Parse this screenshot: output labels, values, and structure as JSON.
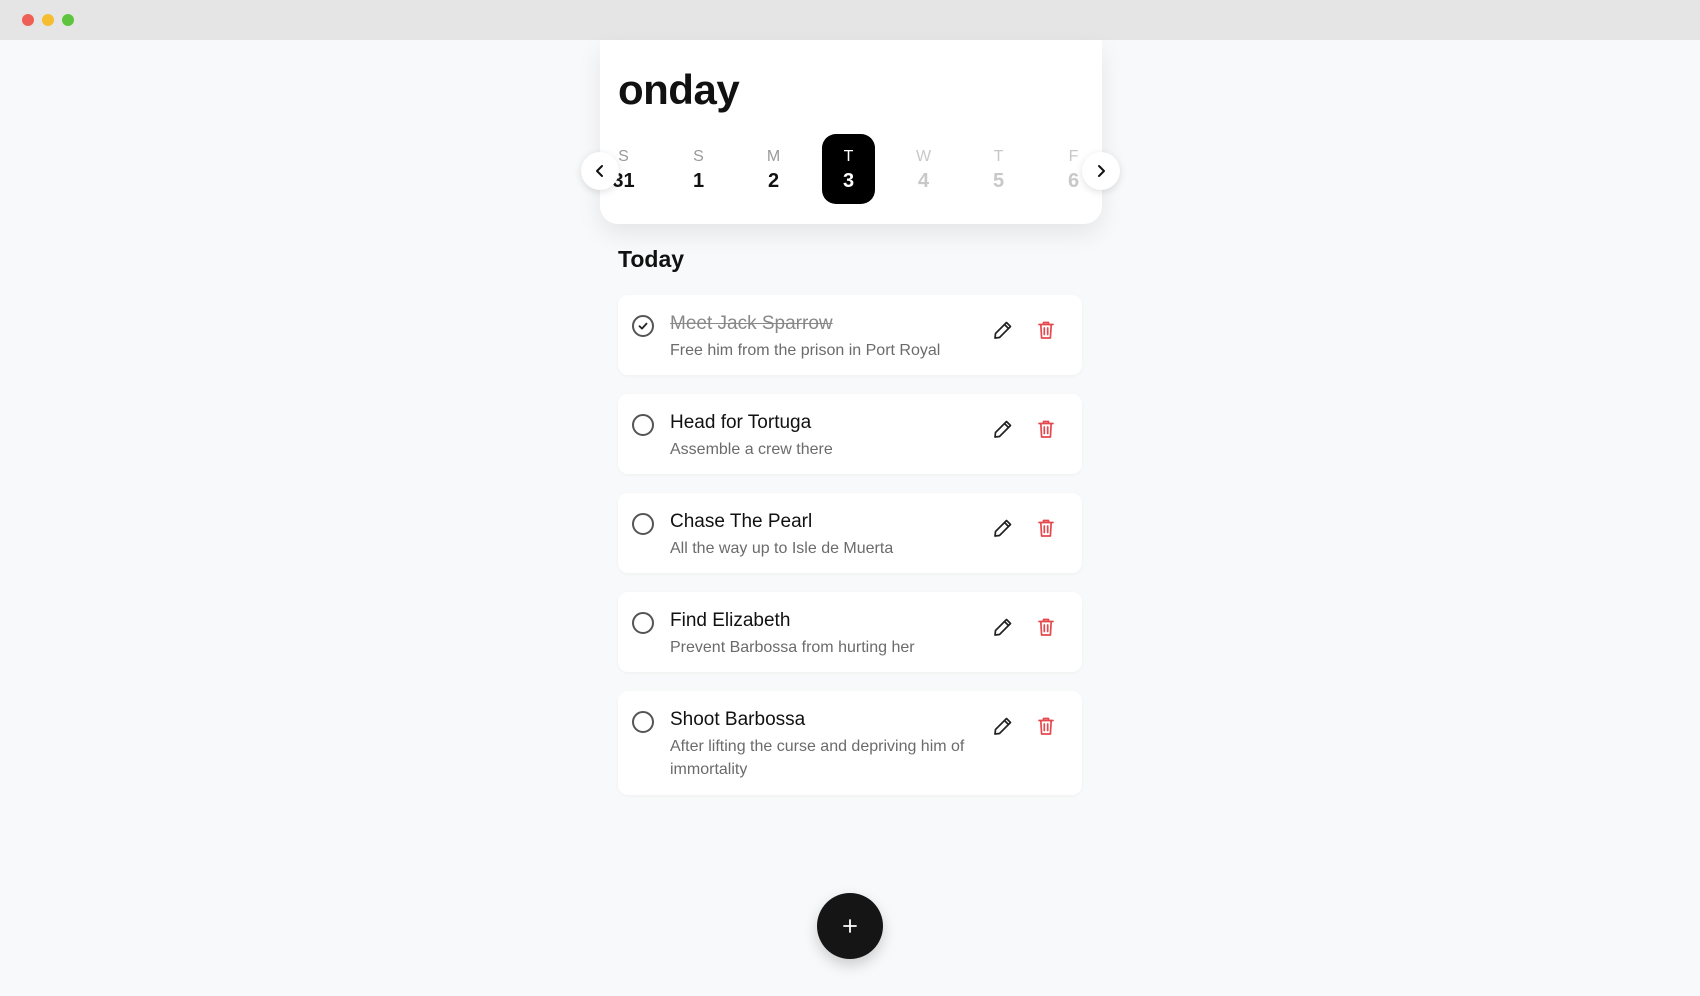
{
  "window": {
    "controls": [
      "close",
      "minimize",
      "zoom"
    ]
  },
  "header": {
    "title": "onday"
  },
  "days": [
    {
      "letter": "S",
      "number": "31",
      "state": "past"
    },
    {
      "letter": "S",
      "number": "1",
      "state": "past"
    },
    {
      "letter": "M",
      "number": "2",
      "state": "past"
    },
    {
      "letter": "T",
      "number": "3",
      "state": "selected"
    },
    {
      "letter": "W",
      "number": "4",
      "state": "future"
    },
    {
      "letter": "T",
      "number": "5",
      "state": "future"
    },
    {
      "letter": "F",
      "number": "6",
      "state": "future"
    }
  ],
  "section": {
    "title": "Today"
  },
  "tasks": [
    {
      "title": "Meet Jack Sparrow",
      "description": "Free him from the prison in Port Royal",
      "done": true
    },
    {
      "title": "Head for Tortuga",
      "description": "Assemble a crew there",
      "done": false
    },
    {
      "title": "Chase The Pearl",
      "description": "All the way up to Isle de Muerta",
      "done": false
    },
    {
      "title": "Find Elizabeth",
      "description": "Prevent Barbossa from hurting her",
      "done": false
    },
    {
      "title": "Shoot Barbossa",
      "description": "After lifting the curse and depriving him of immortality",
      "done": false
    }
  ],
  "icons": {
    "prev": "chevron-left-icon",
    "next": "chevron-right-icon",
    "edit": "pencil-icon",
    "delete": "trash-icon",
    "add": "plus-icon",
    "done": "check-circle-icon",
    "todo": "circle-icon"
  },
  "colors": {
    "accent": "#000000",
    "delete": "#e5484d",
    "background": "#f8f9fa"
  }
}
